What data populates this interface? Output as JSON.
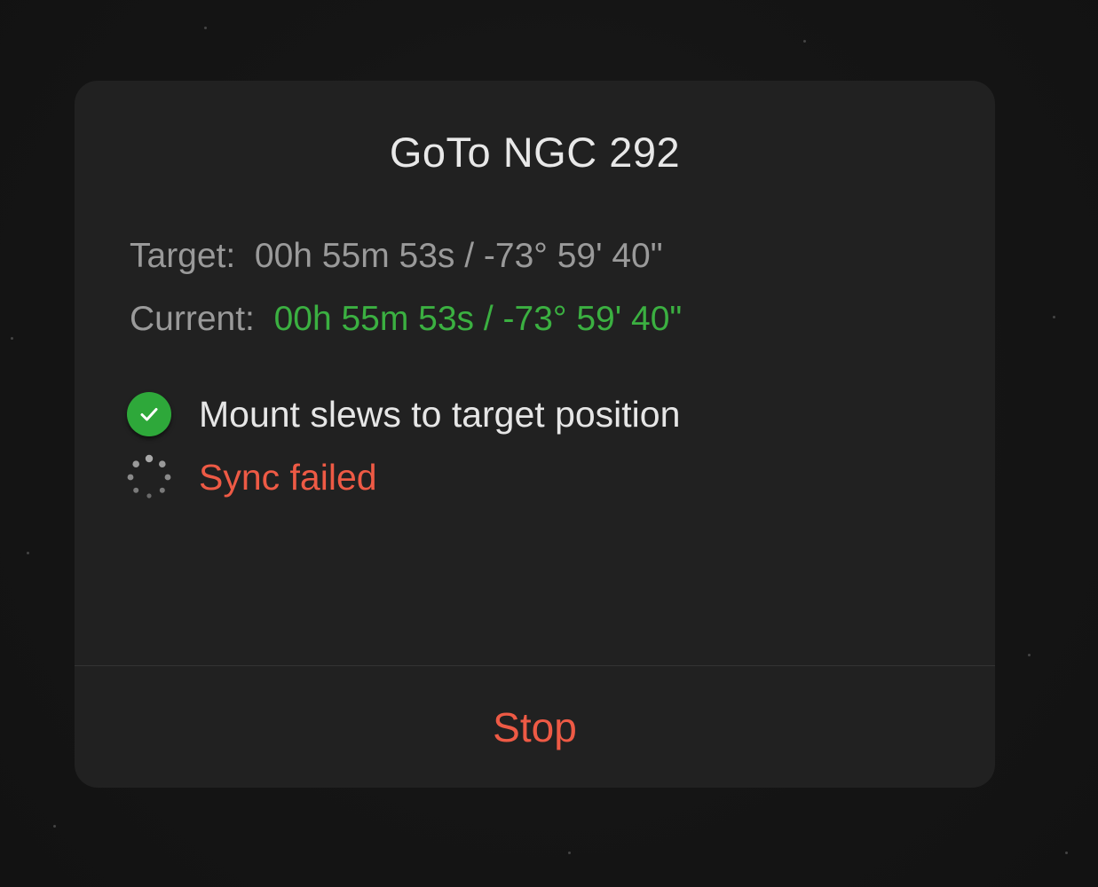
{
  "dialog": {
    "title": "GoTo NGC 292",
    "target": {
      "label": "Target:",
      "value": "00h 55m 53s / -73° 59' 40\""
    },
    "current": {
      "label": "Current:",
      "value": "00h 55m 53s / -73° 59' 40\""
    },
    "steps": [
      {
        "icon": "check-circle-icon",
        "text": "Mount slews to target position",
        "state": "done"
      },
      {
        "icon": "loading-spinner-icon",
        "text": "Sync failed",
        "state": "failed"
      }
    ],
    "stop_label": "Stop"
  },
  "colors": {
    "background": "#141414",
    "dialog": "#212121",
    "title": "#e8e8e8",
    "muted_text": "#9a9a9a",
    "current_value": "#3bb041",
    "success": "#2ea83a",
    "error": "#ee5a45"
  }
}
